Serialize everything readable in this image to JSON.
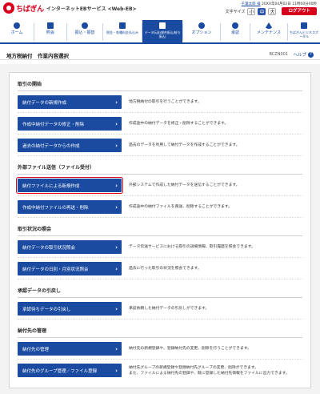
{
  "header": {
    "logo_text": "ちばぎん",
    "service_name": "インターネットEBサービス <Web-EB>",
    "user_name": "千葉太郎 様",
    "last_login": "20XX年04月02日 11時00分00秒",
    "font_size_label": "文字サイズ",
    "font_small": "小",
    "font_medium": "中",
    "font_large": "大",
    "logout_label": "ログアウト"
  },
  "nav": {
    "items": [
      {
        "label": "ホーム",
        "icon": "home-icon"
      },
      {
        "label": "照会",
        "icon": "inquiry-icon"
      },
      {
        "label": "振込・振替",
        "icon": "transfer-icon"
      },
      {
        "label": "税金・各種料金払込み",
        "icon": "tax-payment-icon"
      },
      {
        "label": "データ伝送(総合振込/給与振込)",
        "icon": "data-transmission-icon"
      },
      {
        "label": "オプション",
        "icon": "option-icon"
      },
      {
        "label": "承認",
        "icon": "approval-icon"
      },
      {
        "label": "メンテナンス",
        "icon": "maintenance-icon"
      },
      {
        "label": "ちばぎんビジネスポータル",
        "icon": "portal-icon"
      }
    ],
    "active_index": 4
  },
  "page": {
    "title": "地方税納付　作業内容選択",
    "screen_id": "BCZN001",
    "help_label": "ヘルプ"
  },
  "sections": [
    {
      "title": "取引の開始",
      "rows": [
        {
          "button": "納付データの新規作成",
          "desc": "地方税納付の取引を行うことができます。"
        },
        {
          "button": "作成中納付データの修正・削除",
          "desc": "作成途中の納付データを修正・削除することができます。"
        },
        {
          "button": "過去の納付データからの作成",
          "desc": "過去のデータを利用して納付データを作成することができます。"
        }
      ]
    },
    {
      "title": "外部ファイル送信（ファイル受付）",
      "rows": [
        {
          "button": "納付ファイルによる新規作成",
          "desc": "外部システムで作成した納付データを送信することができます。",
          "highlighted": true
        },
        {
          "button": "作成中納付ファイルの再送・削除",
          "desc": "作成途中の納付ファイルを再送、削除することができます。"
        }
      ]
    },
    {
      "title": "取引状況の照会",
      "rows": [
        {
          "button": "納付データの取引状況照会",
          "desc": "データ伝送サービスにおける取引の詳細情報、取引履歴を照会できます。"
        },
        {
          "button": "納付データの日別・月別状況照会",
          "desc": "過去に行った取引の状況を照会できます。"
        }
      ]
    },
    {
      "title": "承認データの引戻し",
      "rows": [
        {
          "button": "承認待ちデータの引戻し",
          "desc": "承認依頼した納付データの引戻しができます。"
        }
      ]
    },
    {
      "title": "納付先の管理",
      "rows": [
        {
          "button": "納付先の管理",
          "desc": "納付先の新規登録や、登録納付先の変更、削除を行うことができます。"
        },
        {
          "button": "納付先のグループ管理／ファイル登録",
          "desc": "納付先グループの新規登録や登録納付先グループの変更、削除ができます。",
          "desc2": "また、ファイルによる納付先の登録や、既に登録した納付先情報をファイルに出力できます。"
        }
      ]
    }
  ],
  "colors": {
    "primary": "#1a4ba0",
    "brand_red": "#d6001c",
    "highlight": "#e0001a"
  }
}
